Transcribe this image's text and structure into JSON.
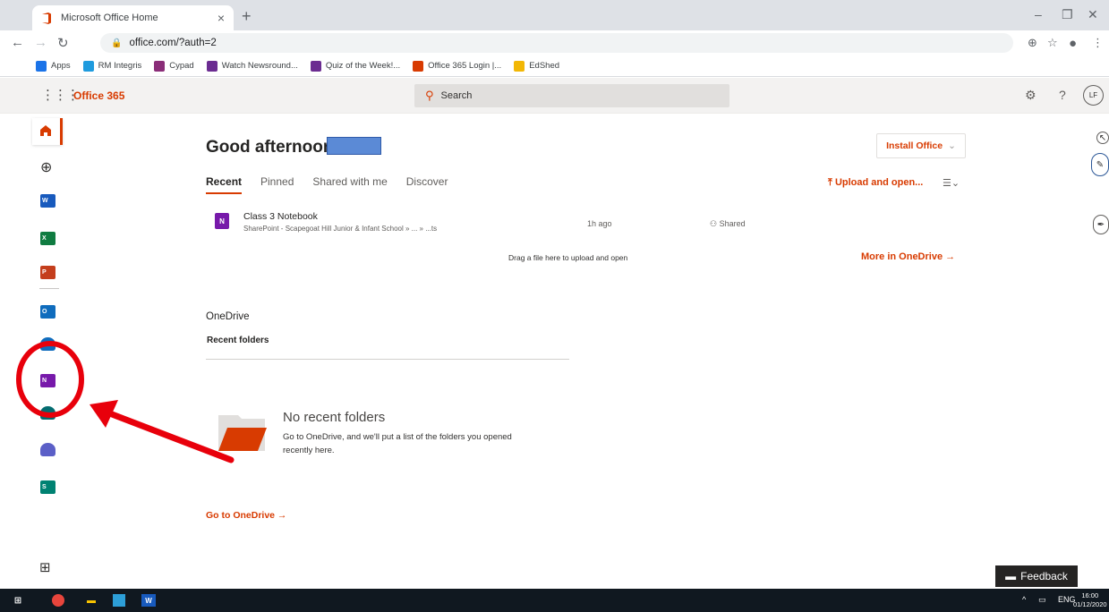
{
  "browser": {
    "tab_title": "Microsoft Office Home",
    "tab_close": "×",
    "new_tab": "+",
    "url": "office.com/?auth=2",
    "bookmarks": [
      {
        "label": "Apps",
        "color": "#1a73e8"
      },
      {
        "label": "RM Integris",
        "color": "#1f9bde"
      },
      {
        "label": "Cypad",
        "color": "#8a2d78"
      },
      {
        "label": "Watch Newsround...",
        "color": "#6b2c91"
      },
      {
        "label": "Quiz of the Week!...",
        "color": "#6b2c91"
      },
      {
        "label": "Office 365 Login |...",
        "color": "#d83b01"
      },
      {
        "label": "EdShed",
        "color": "#f2b705"
      }
    ]
  },
  "office": {
    "brand": "Office 365",
    "search_placeholder": "Search",
    "avatar_initials": "LF",
    "greeting": "Good afternoon,",
    "install_office": "Install Office",
    "tabs": [
      "Recent",
      "Pinned",
      "Shared with me",
      "Discover"
    ],
    "upload_open": "Upload and open...",
    "recent_file": {
      "name": "Class 3 Notebook",
      "path": "SharePoint - Scapegoat Hill Junior & Infant School » ... » ...ts",
      "time": "1h ago",
      "shared": "Shared"
    },
    "drag_hint": "Drag a file here to upload and open",
    "more_in_onedrive": "More in OneDrive →",
    "onedrive_title": "OneDrive",
    "recent_folders": "Recent folders",
    "no_recent_title": "No recent folders",
    "no_recent_desc": "Go to OneDrive, and we'll put a list of the folders you opened recently here.",
    "go_to_onedrive": "Go to OneDrive →",
    "feedback": "Feedback"
  },
  "rail_apps": [
    {
      "name": "word",
      "letter": "W",
      "color": "#185abd"
    },
    {
      "name": "excel",
      "letter": "X",
      "color": "#107c41"
    },
    {
      "name": "powerpoint",
      "letter": "P",
      "color": "#c43e1c"
    },
    {
      "name": "outlook",
      "letter": "O",
      "color": "#0f6cbd"
    },
    {
      "name": "onedrive",
      "letter": "",
      "color": "#0f6cbd"
    },
    {
      "name": "onenote",
      "letter": "N",
      "color": "#7719aa"
    },
    {
      "name": "sharepoint",
      "letter": "",
      "color": "#036c70"
    },
    {
      "name": "teams",
      "letter": "",
      "color": "#5b5fc7"
    },
    {
      "name": "sway",
      "letter": "S",
      "color": "#008272"
    }
  ],
  "taskbar": {
    "lang": "ENG",
    "time": "16:00",
    "date": "01/12/2020"
  },
  "colors": {
    "accent": "#d83b01",
    "annotation": "#e8000b"
  }
}
